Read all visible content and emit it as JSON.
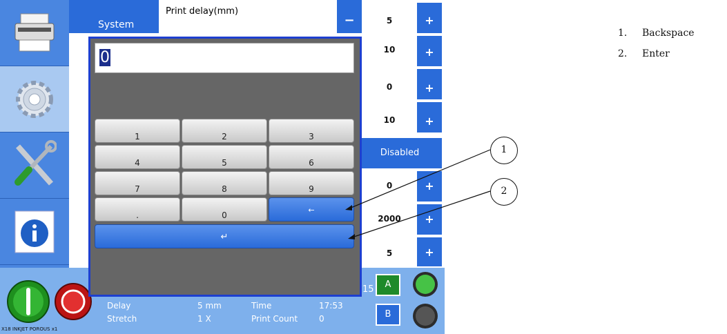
{
  "header": {
    "tab_label": "System",
    "setting_label": "Print delay(mm)",
    "minus_label": "−",
    "plus_label": "+"
  },
  "values": [
    "5",
    "10",
    "0",
    "10",
    "Disabled",
    "0",
    "2000",
    "5"
  ],
  "numpad": {
    "display_value": "0",
    "keys": [
      "1",
      "2",
      "3",
      "4",
      "5",
      "6",
      "7",
      "8",
      "9",
      ".",
      "0"
    ],
    "backspace_icon": "backspace-arrow-icon",
    "enter_icon": "enter-return-icon"
  },
  "status": {
    "delay_label": "Delay",
    "delay_value": "5 mm",
    "stretch_label": "Stretch",
    "stretch_value": "1 X",
    "time_label": "Time",
    "time_value": "17:53",
    "count_label": "Print Count",
    "count_value": "0",
    "partial_number": "15",
    "head_a": "A",
    "head_b": "B",
    "device_name": "X18 INKJET POROUS x1"
  },
  "callouts": {
    "c1": "1",
    "c2": "2"
  },
  "legend": [
    {
      "num": "1.",
      "label": "Backspace"
    },
    {
      "num": "2.",
      "label": "Enter"
    }
  ],
  "colors": {
    "accent": "#2a6bd9",
    "panel": "#666666",
    "status_bar": "#7eb0ec",
    "head_a": "#1e8a2a"
  }
}
